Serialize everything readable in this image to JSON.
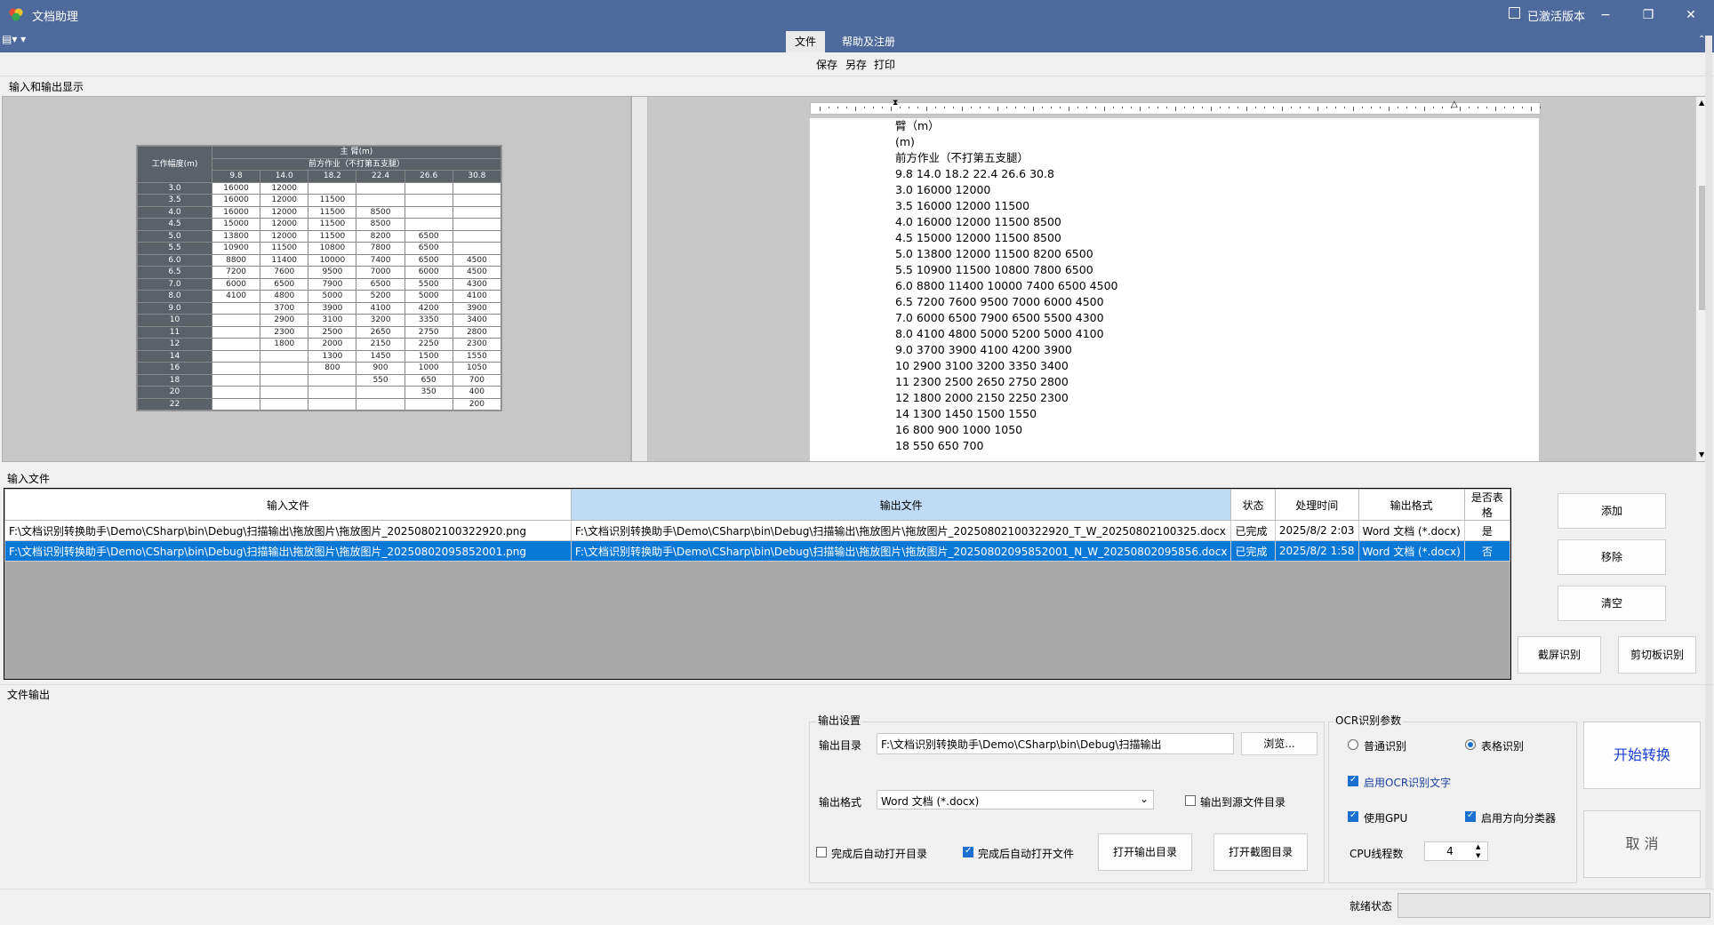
{
  "window": {
    "title": "文档助理",
    "activated_label": "已激活版本",
    "minimize": "−",
    "maximize": "❐",
    "close": "✕"
  },
  "quick_access": "▤▾  ▾",
  "menu": {
    "tabs": [
      "文件",
      "帮助及注册"
    ]
  },
  "toolbar": {
    "save": "保存",
    "save_as": "另存",
    "print": "打印"
  },
  "preview": {
    "section_label": "输入和输出显示",
    "thumb": {
      "title": "主 臂(m)",
      "subtitle": "前方作业（不打第五支腿）",
      "col_header": "工作幅度(m)",
      "cols": [
        "9.8",
        "14.0",
        "18.2",
        "22.4",
        "26.6",
        "30.8"
      ],
      "rows": [
        [
          "3.0",
          "16000",
          "12000",
          "",
          "",
          "",
          ""
        ],
        [
          "3.5",
          "16000",
          "12000",
          "11500",
          "",
          "",
          ""
        ],
        [
          "4.0",
          "16000",
          "12000",
          "11500",
          "8500",
          "",
          ""
        ],
        [
          "4.5",
          "15000",
          "12000",
          "11500",
          "8500",
          "",
          ""
        ],
        [
          "5.0",
          "13800",
          "12000",
          "11500",
          "8200",
          "6500",
          ""
        ],
        [
          "5.5",
          "10900",
          "11500",
          "10800",
          "7800",
          "6500",
          ""
        ],
        [
          "6.0",
          "8800",
          "11400",
          "10000",
          "7400",
          "6500",
          "4500"
        ],
        [
          "6.5",
          "7200",
          "7600",
          "9500",
          "7000",
          "6000",
          "4500"
        ],
        [
          "7.0",
          "6000",
          "6500",
          "7900",
          "6500",
          "5500",
          "4300"
        ],
        [
          "8.0",
          "4100",
          "4800",
          "5000",
          "5200",
          "5000",
          "4100"
        ],
        [
          "9.0",
          "",
          "3700",
          "3900",
          "4100",
          "4200",
          "3900"
        ],
        [
          "10",
          "",
          "2900",
          "3100",
          "3200",
          "3350",
          "3400"
        ],
        [
          "11",
          "",
          "2300",
          "2500",
          "2650",
          "2750",
          "2800"
        ],
        [
          "12",
          "",
          "1800",
          "2000",
          "2150",
          "2250",
          "2300"
        ],
        [
          "14",
          "",
          "",
          "1300",
          "1450",
          "1500",
          "1550"
        ],
        [
          "16",
          "",
          "",
          "800",
          "900",
          "1000",
          "1050"
        ],
        [
          "18",
          "",
          "",
          "",
          "550",
          "650",
          "700"
        ],
        [
          "20",
          "",
          "",
          "",
          "",
          "350",
          "400"
        ],
        [
          "22",
          "",
          "",
          "",
          "",
          "",
          "200"
        ]
      ]
    },
    "doc_lines": [
      "臂（m）",
      "(m)",
      "前方作业（不打第五支腿）",
      "9.8 14.0 18.2 22.4 26.6 30.8",
      "3.0 16000 12000",
      "3.5 16000 12000 11500",
      "4.0 16000 12000 11500 8500",
      "4.5 15000 12000 11500 8500",
      "5.0 13800 12000 11500 8200 6500",
      "5.5 10900 11500 10800 7800 6500",
      "6.0 8800 11400 10000 7400 6500 4500",
      "6.5 7200 7600 9500 7000 6000 4500",
      "7.0 6000 6500 7900 6500 5500 4300",
      "8.0 4100 4800 5000 5200 5000 4100",
      "9.0 3700 3900 4100 4200 3900",
      "10 2900 3100 3200 3350 3400",
      "11 2300 2500 2650 2750 2800",
      "12 1800 2000 2150 2250 2300",
      "14 1300 1450 1500 1550",
      "16 800 900 1000 1050",
      "18 550 650 700"
    ],
    "ruler_numbers": [
      "1",
      "1",
      "2",
      "1",
      "2",
      "3",
      "4",
      "5",
      "6",
      "7"
    ]
  },
  "input_files": {
    "section_label": "输入文件",
    "columns": [
      "输入文件",
      "输出文件",
      "状态",
      "处理时间",
      "输出格式",
      "是否表格"
    ],
    "rows": [
      [
        "F:\\文档识别转换助手\\Demo\\CSharp\\bin\\Debug\\扫描输出\\拖放图片\\拖放图片_20250802100322920.png",
        "F:\\文档识别转换助手\\Demo\\CSharp\\bin\\Debug\\扫描输出\\拖放图片\\拖放图片_20250802100322920_T_W_20250802100325.docx",
        "已完成",
        "2025/8/2 2:03",
        "Word 文档 (*.docx)",
        "是"
      ],
      [
        "F:\\文档识别转换助手\\Demo\\CSharp\\bin\\Debug\\扫描输出\\拖放图片\\拖放图片_20250802095852001.png",
        "F:\\文档识别转换助手\\Demo\\CSharp\\bin\\Debug\\扫描输出\\拖放图片\\拖放图片_20250802095852001_N_W_20250802095856.docx",
        "已完成",
        "2025/8/2 1:58",
        "Word 文档 (*.docx)",
        "否"
      ]
    ],
    "buttons": {
      "add": "添加",
      "remove": "移除",
      "clear": "清空",
      "screen_ocr": "截屏识别",
      "clipboard_ocr": "剪切板识别"
    }
  },
  "file_output": {
    "section_label": "文件输出"
  },
  "output_settings": {
    "group_label": "输出设置",
    "dir_label": "输出目录",
    "dir_value": "F:\\文档识别转换助手\\Demo\\CSharp\\bin\\Debug\\扫描输出",
    "browse": "浏览...",
    "format_label": "输出格式",
    "format_value": "Word 文档 (*.docx)",
    "to_source_dir": "输出到源文件目录",
    "auto_open_dir": "完成后自动打开目录",
    "auto_open_file": "完成后自动打开文件",
    "open_output_dir": "打开输出目录",
    "open_screenshot_dir": "打开截图目录"
  },
  "ocr": {
    "group_label": "OCR识别参数",
    "normal": "普通识别",
    "table": "表格识别",
    "enable_text": "启用OCR识别文字",
    "use_gpu": "使用GPU",
    "direction_cls": "启用方向分类器",
    "cpu_threads_label": "CPU线程数",
    "cpu_threads": "4",
    "start": "开始转换",
    "cancel": "取 消"
  },
  "status": {
    "label": "就绪状态"
  }
}
